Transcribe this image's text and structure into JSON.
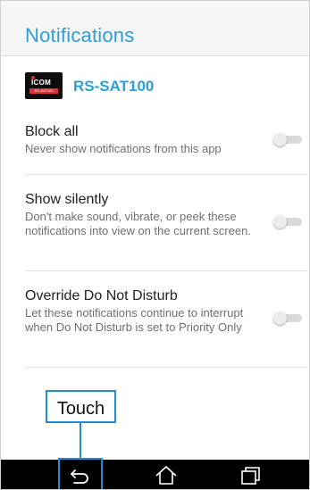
{
  "screen": {
    "title": "Notifications"
  },
  "app": {
    "name": "RS-SAT100",
    "icon": "icom-app-icon",
    "icon_brand": "ICOM",
    "icon_subtext": "RS-SAT100"
  },
  "prefs": [
    {
      "title": "Block all",
      "summary": "Never show notifications from this app",
      "enabled": false
    },
    {
      "title": "Show silently",
      "summary": "Don't make sound, vibrate, or peek these notifications into view on the current screen.",
      "enabled": false
    },
    {
      "title": "Override Do Not Disturb",
      "summary": "Let these notifications continue to interrupt when Do Not Disturb is set to Priority Only",
      "enabled": false
    }
  ],
  "navbar": {
    "back_icon": "back-icon",
    "home_icon": "home-icon",
    "recents_icon": "recents-icon"
  },
  "callout": {
    "label": "Touch"
  },
  "colors": {
    "accent": "#2a9fd8",
    "callout": "#1f8ed6",
    "navbar": "#000000"
  }
}
